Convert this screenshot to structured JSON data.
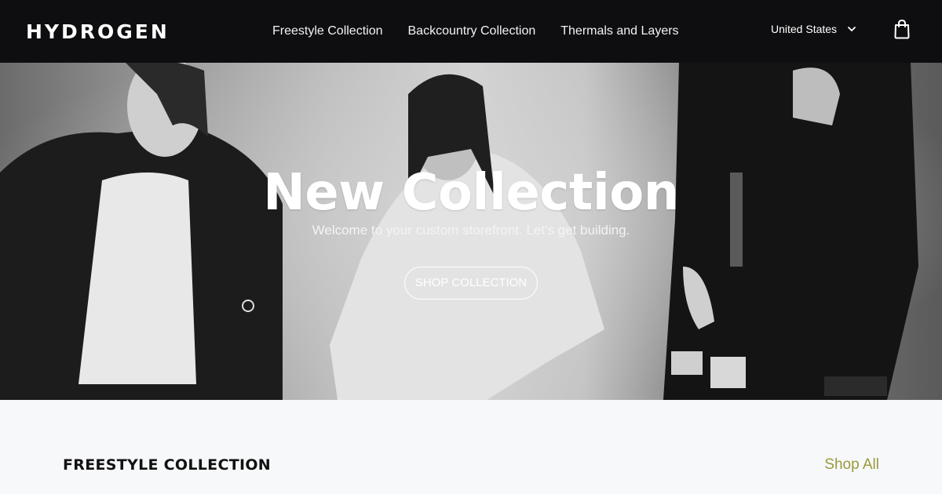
{
  "header": {
    "logo": "HYDROGEN",
    "nav": [
      {
        "label": "Freestyle Collection"
      },
      {
        "label": "Backcountry Collection"
      },
      {
        "label": "Thermals and Layers"
      }
    ],
    "country": "United States",
    "icons": {
      "country_chevron": "chevron-down-icon",
      "cart": "shopping-bag-icon"
    }
  },
  "hero": {
    "title": "New Collection",
    "subtitle": "Welcome to your custom storefront. Let’s get building.",
    "cta_label": "SHOP COLLECTION"
  },
  "section": {
    "title": "FREESTYLE COLLECTION",
    "link": "Shop All"
  },
  "colors": {
    "header_bg": "#0e0e10",
    "accent_link": "#9a9a3c",
    "page_bg": "#f7f8fa"
  }
}
